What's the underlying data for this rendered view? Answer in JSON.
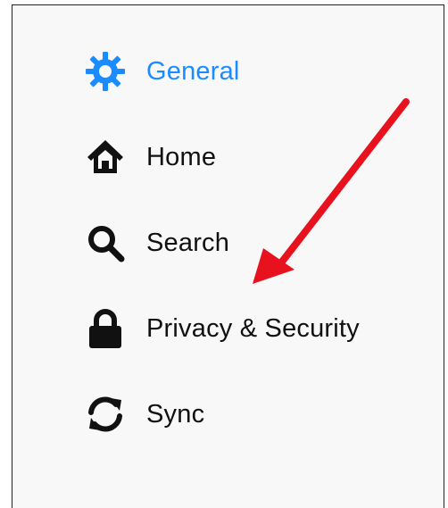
{
  "sidebar": {
    "items": [
      {
        "label": "General",
        "icon": "gear-icon",
        "active": true
      },
      {
        "label": "Home",
        "icon": "home-icon",
        "active": false
      },
      {
        "label": "Search",
        "icon": "search-icon",
        "active": false
      },
      {
        "label": "Privacy & Security",
        "icon": "lock-icon",
        "active": false
      },
      {
        "label": "Sync",
        "icon": "sync-icon",
        "active": false
      }
    ]
  },
  "colors": {
    "accent": "#1a8cff",
    "text": "#111111",
    "panel_background": "#f8f8f8",
    "annotation_arrow": "#e8111e"
  }
}
